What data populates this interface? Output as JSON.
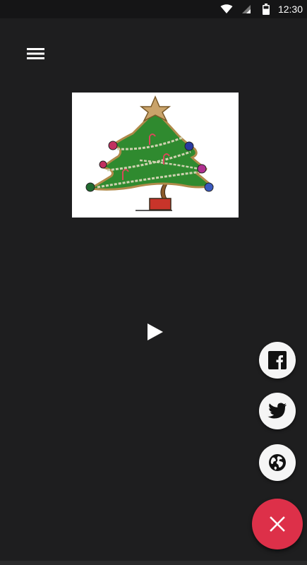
{
  "status_bar": {
    "time": "12:30",
    "icons": [
      "wifi-icon",
      "signal-icon",
      "battery-icon"
    ]
  },
  "toolbar": {
    "menu_icon": "hamburger-menu-icon"
  },
  "artwork": {
    "subject": "christmas-tree-drawing"
  },
  "player": {
    "play_icon": "play-icon"
  },
  "share_actions": [
    {
      "name": "facebook",
      "icon": "facebook-icon"
    },
    {
      "name": "twitter",
      "icon": "twitter-icon"
    },
    {
      "name": "website",
      "icon": "globe-icon"
    }
  ],
  "fab": {
    "icon": "close-icon"
  },
  "colors": {
    "background": "#1e1e1f",
    "status_bar": "#151516",
    "fab_accent": "#dd3049",
    "fab_small_bg": "#f5f5f5"
  }
}
